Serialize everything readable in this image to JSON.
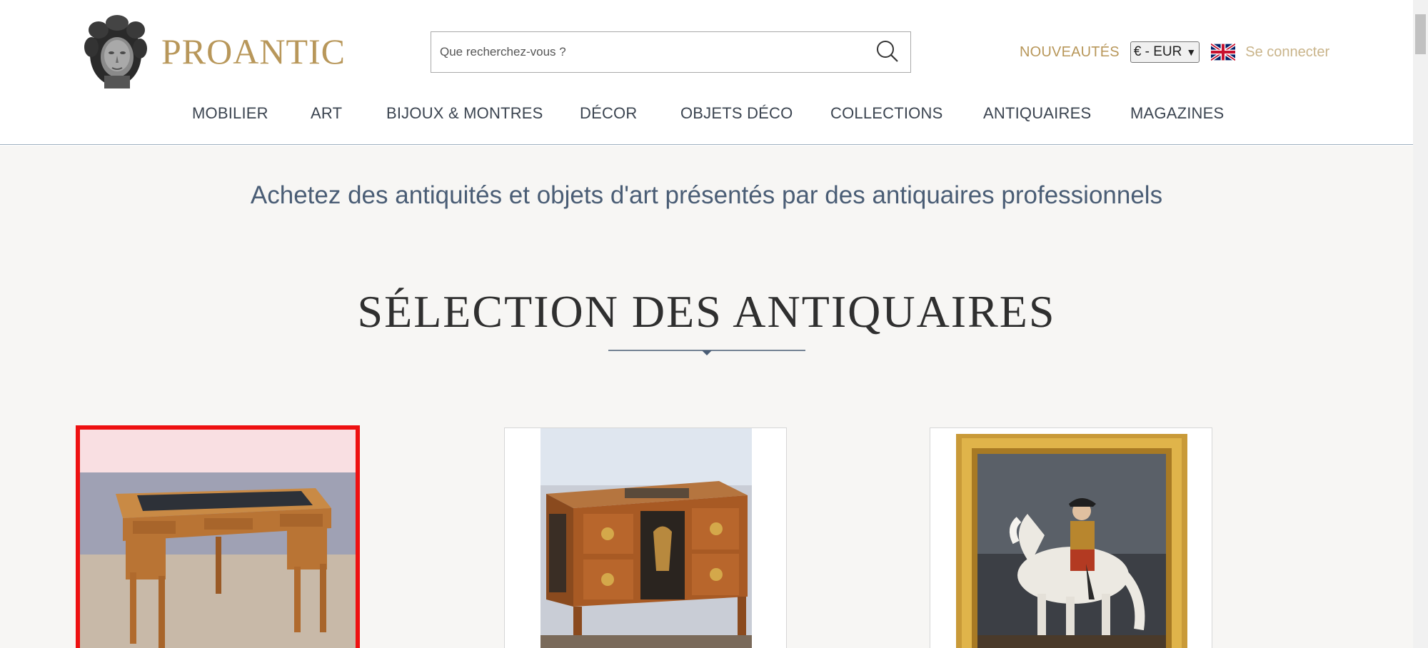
{
  "header": {
    "brand": "PROANTIC",
    "logo_icon": "bust-sculpture-logo",
    "search": {
      "placeholder": "Que recherchez-vous ?",
      "icon": "search-icon"
    },
    "new_link": "NOUVEAUTÉS",
    "currency": "€ - EUR",
    "language_flag": "uk-flag-icon",
    "login": "Se connecter"
  },
  "nav": {
    "items": [
      {
        "label": "MOBILIER"
      },
      {
        "label": "ART"
      },
      {
        "label": "BIJOUX & MONTRES"
      },
      {
        "label": "DÉCOR"
      },
      {
        "label": "OBJETS DÉCO"
      },
      {
        "label": "COLLECTIONS"
      },
      {
        "label": "ANTIQUAIRES"
      },
      {
        "label": "MAGAZINES"
      }
    ]
  },
  "main": {
    "tagline": "Achetez des antiquités et objets d'art présentés par des antiquaires professionnels",
    "section_title": "SÉLECTION DES ANTIQUAIRES",
    "cards": [
      {
        "image": "writing-desk-photo",
        "selected": true
      },
      {
        "image": "marquetry-commode-photo",
        "selected": false
      },
      {
        "image": "equestrian-portrait-painting",
        "selected": false
      }
    ]
  },
  "colors": {
    "brand_gold": "#b8975a",
    "nav_text": "#3b4450",
    "tagline_blue": "#4a5d75",
    "selection_red": "#ee1111",
    "page_bg": "#f7f6f4"
  }
}
